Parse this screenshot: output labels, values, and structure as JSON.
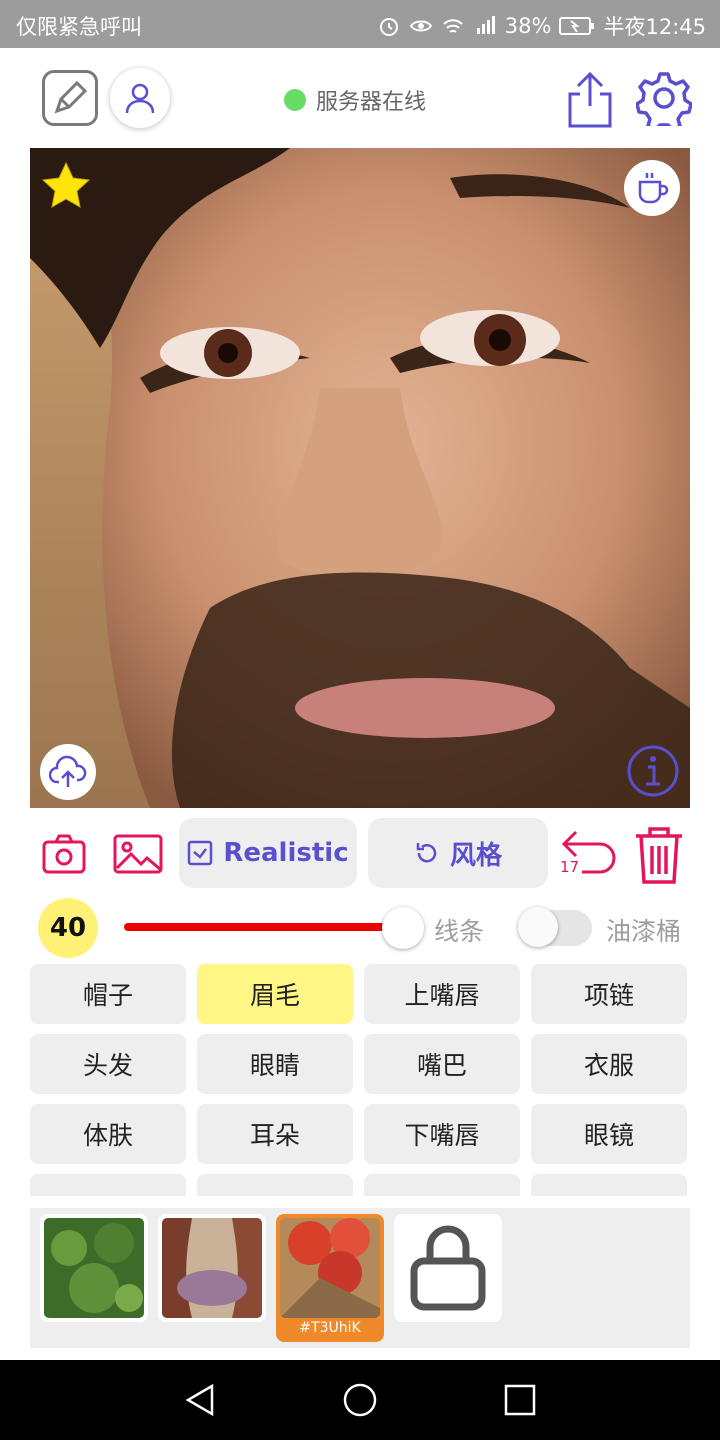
{
  "status_bar": {
    "carrier": "仅限紧急呼叫",
    "battery": "38%",
    "time": "半夜12:45"
  },
  "header": {
    "server_status": "服务器在线",
    "server_status_color": "#66dd66"
  },
  "toolbar": {
    "realistic_label": "Realistic",
    "style_label": "风格",
    "undo_count": "17",
    "accent_color": "#e3165b",
    "pill_text_color": "#5a4fcf"
  },
  "brush": {
    "size": "40",
    "slider_fraction": 0.8,
    "line_label": "线条",
    "bucket_label": "油漆桶",
    "bucket_enabled": false,
    "track_color": "#ee0000"
  },
  "parts": [
    {
      "label": "帽子",
      "selected": false
    },
    {
      "label": "眉毛",
      "selected": true
    },
    {
      "label": "上嘴唇",
      "selected": false
    },
    {
      "label": "项链",
      "selected": false
    },
    {
      "label": "头发",
      "selected": false
    },
    {
      "label": "眼睛",
      "selected": false
    },
    {
      "label": "嘴巴",
      "selected": false
    },
    {
      "label": "衣服",
      "selected": false
    },
    {
      "label": "体肤",
      "selected": false
    },
    {
      "label": "耳朵",
      "selected": false
    },
    {
      "label": "下嘴唇",
      "selected": false
    },
    {
      "label": "眼镜",
      "selected": false
    }
  ],
  "styles": {
    "active_label": "#T3UhiK",
    "active_color": "#ee8a2a"
  },
  "icons": {
    "edit": "edit-icon",
    "user": "user-icon",
    "share": "share-icon",
    "settings": "gear-icon",
    "favorite": "star-icon",
    "coffee": "coffee-icon",
    "upload": "cloud-upload-icon",
    "info": "info-icon",
    "camera": "camera-icon",
    "gallery": "image-icon",
    "undo": "undo-icon",
    "delete": "trash-icon",
    "lock": "lock-icon"
  }
}
